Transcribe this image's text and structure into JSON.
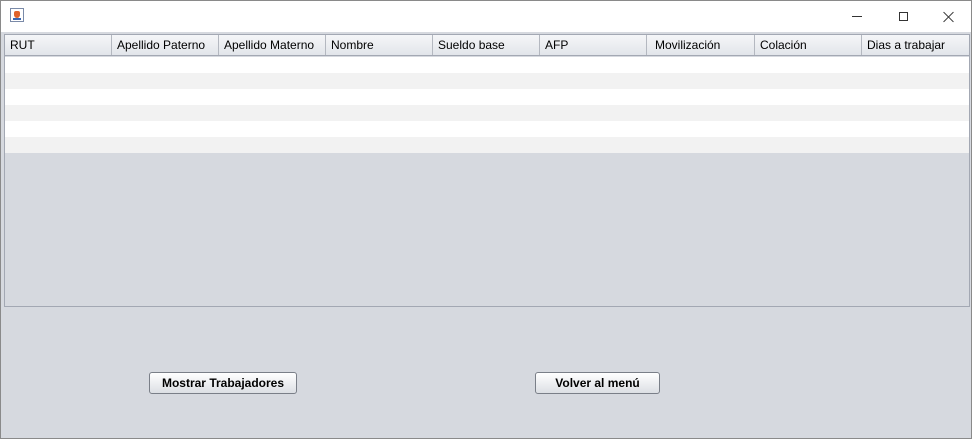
{
  "window": {
    "icon": "java-cup-icon",
    "controls": [
      "minimize-icon",
      "maximize-icon",
      "close-icon"
    ]
  },
  "table": {
    "columns": [
      "RUT",
      "Apellido Paterno",
      "Apellido Materno",
      "Nombre",
      "Sueldo base",
      "AFP",
      "Movilización",
      "Colación",
      "Dias a trabajar"
    ],
    "rows": [
      [
        "",
        "",
        "",
        "",
        "",
        "",
        "",
        "",
        ""
      ],
      [
        "",
        "",
        "",
        "",
        "",
        "",
        "",
        "",
        ""
      ],
      [
        "",
        "",
        "",
        "",
        "",
        "",
        "",
        "",
        ""
      ],
      [
        "",
        "",
        "",
        "",
        "",
        "",
        "",
        "",
        ""
      ],
      [
        "",
        "",
        "",
        "",
        "",
        "",
        "",
        "",
        ""
      ],
      [
        "",
        "",
        "",
        "",
        "",
        "",
        "",
        "",
        ""
      ]
    ]
  },
  "buttons": {
    "show_workers": "Mostrar Trabajadores",
    "back_to_menu": "Volver al menú"
  }
}
